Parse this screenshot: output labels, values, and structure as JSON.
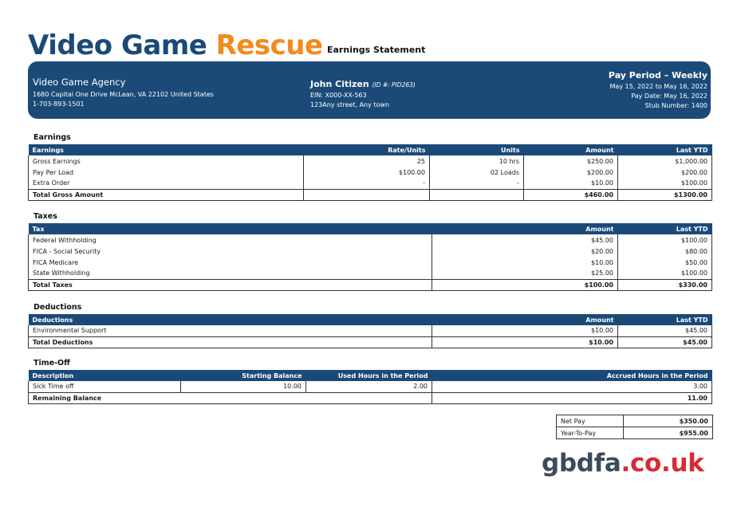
{
  "header": {
    "brand_part1": "Video Game ",
    "brand_part2": "Rescue",
    "statement_title": "Earnings Statement"
  },
  "company": {
    "name": "Video Game Agency",
    "address": "1680 Capital One Drive McLean, VA 22102 United States",
    "phone": "1-703-893-1501"
  },
  "employee": {
    "name": "John Citizen",
    "id_label": "(ID #:  PID263)",
    "ein": "EIN: X000-XX-563",
    "address": "123Any street, Any town"
  },
  "pay_period": {
    "title": "Pay Period – Weekly",
    "range": "May 15, 2022 to May 16, 2022",
    "pay_date": "Pay Date: May 16, 2022",
    "stub": "Stub Number: 1400"
  },
  "earnings": {
    "section_title": "Earnings",
    "headers": [
      "Earnings",
      "Rate/Units",
      "Units",
      "Amount",
      "Last YTD"
    ],
    "rows": [
      [
        "Gross Earnings",
        "25",
        "10 hrs",
        "$250.00",
        "$1,000.00"
      ],
      [
        "Pay Per Load",
        "$100.00",
        "02 Loads",
        "$200.00",
        "$200.00"
      ],
      [
        "Extra Order",
        "-",
        "-",
        "$10.00",
        "$100.00"
      ]
    ],
    "total": [
      "Total Gross Amount",
      "",
      "",
      "$460.00",
      "$1300.00"
    ]
  },
  "taxes": {
    "section_title": "Taxes",
    "headers": [
      "Tax",
      "Amount",
      "Last YTD"
    ],
    "rows": [
      [
        "Federal Withholding",
        "$45.00",
        "$100.00"
      ],
      [
        "FICA - Social Security",
        "$20.00",
        "$80.00"
      ],
      [
        "FICA Medicare",
        "$10.00",
        "$50.00"
      ],
      [
        "State Withholding",
        "$25.00",
        "$100.00"
      ]
    ],
    "total": [
      "Total Taxes",
      "$100.00",
      "$330.00"
    ]
  },
  "deductions": {
    "section_title": "Deductions",
    "headers": [
      "Deductions",
      "Amount",
      "Last YTD"
    ],
    "rows": [
      [
        "Environmental Support",
        "$10.00",
        "$45.00"
      ]
    ],
    "total": [
      "Total Deductions",
      "$10.00",
      "$45.00"
    ]
  },
  "timeoff": {
    "section_title": "Time-Off",
    "headers": [
      "Description",
      "Starting Balance",
      "Used Hours in the Period",
      "Accrued Hours in the Period"
    ],
    "rows": [
      [
        "Sick Time off",
        "10.00",
        "2.00",
        "3.00"
      ]
    ],
    "total": [
      "Remaining Balance",
      "11.00"
    ]
  },
  "summary": {
    "rows": [
      [
        "Net Pay",
        "$350.00"
      ],
      [
        "Year-To-Pay",
        "$955.00"
      ]
    ]
  },
  "watermark": {
    "part1": "gbdfa",
    "part2": ".co.uk"
  },
  "colors": {
    "brand_blue": "#1b4a78",
    "brand_orange": "#f28a1c",
    "watermark_gray": "#3c4a5c",
    "watermark_red": "#d62b35"
  }
}
